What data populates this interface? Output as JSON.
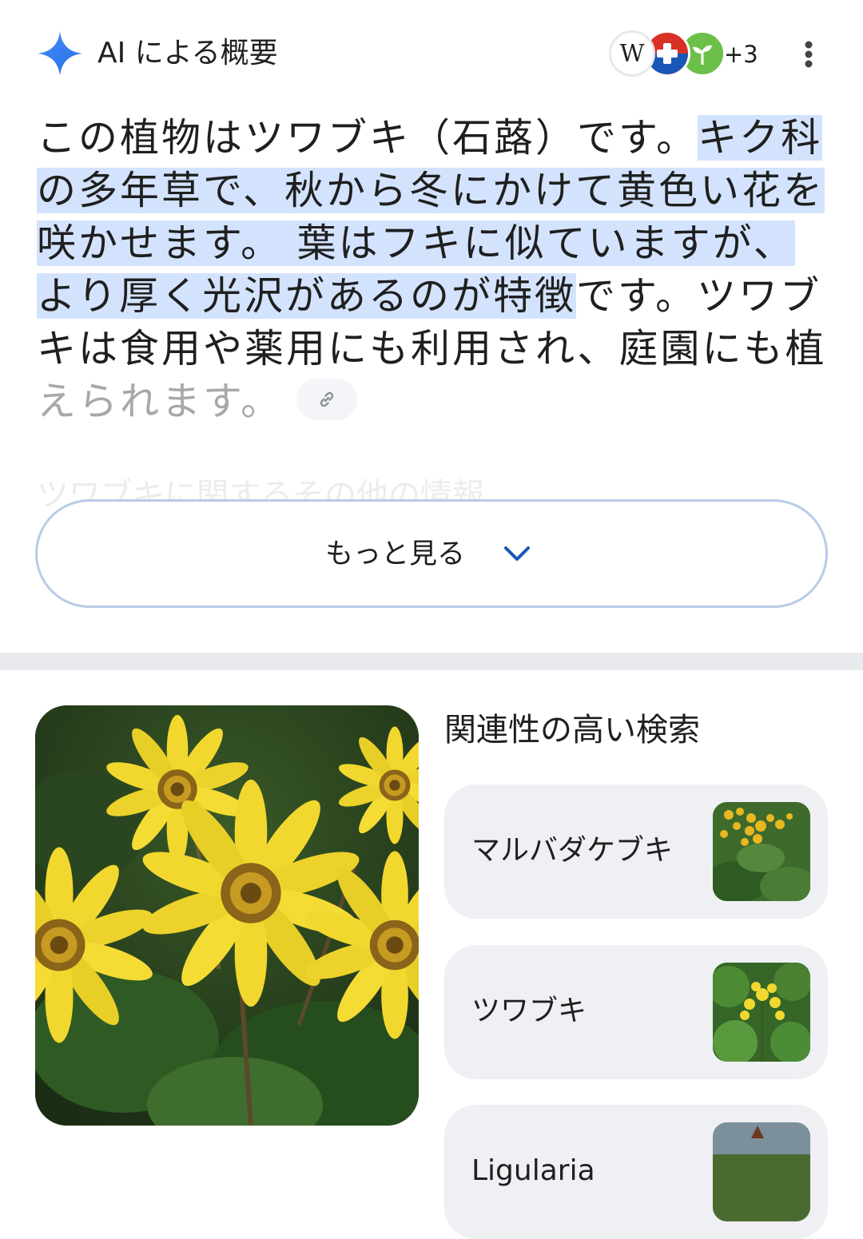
{
  "ai_overview": {
    "title": "AI による概要",
    "sources_more": "+3",
    "icons": {
      "spark": "gemini-spark-icon",
      "menu": "more-vert-icon",
      "link": "link-icon"
    },
    "colors": {
      "spark": "#3b82f6",
      "highlight": "#d3e3fd"
    },
    "lines": [
      {
        "plain": "この植物はツワブキ（石蕗）です。",
        "hl": "キク科"
      },
      {
        "hl": "の多年草で、秋から冬にかけて黄色い花を"
      },
      {
        "hl": "咲かせます。 葉はフキに似ていますが、"
      },
      {
        "hl": "より厚く光沢があるのが特徴",
        "plain": "です。ツワブ"
      },
      {
        "plain": "キは食用や薬用にも利用され、庭園にも植"
      },
      {
        "plain": "えられます。"
      }
    ],
    "ghost_text": "ツワブキに関するその他の情報"
  },
  "show_more": {
    "label": "もっと見る"
  },
  "related": {
    "title": "関連性の高い検索",
    "items": [
      {
        "label": "マルバダケブキ"
      },
      {
        "label": "ツワブキ"
      },
      {
        "label": "Ligularia"
      }
    ]
  }
}
